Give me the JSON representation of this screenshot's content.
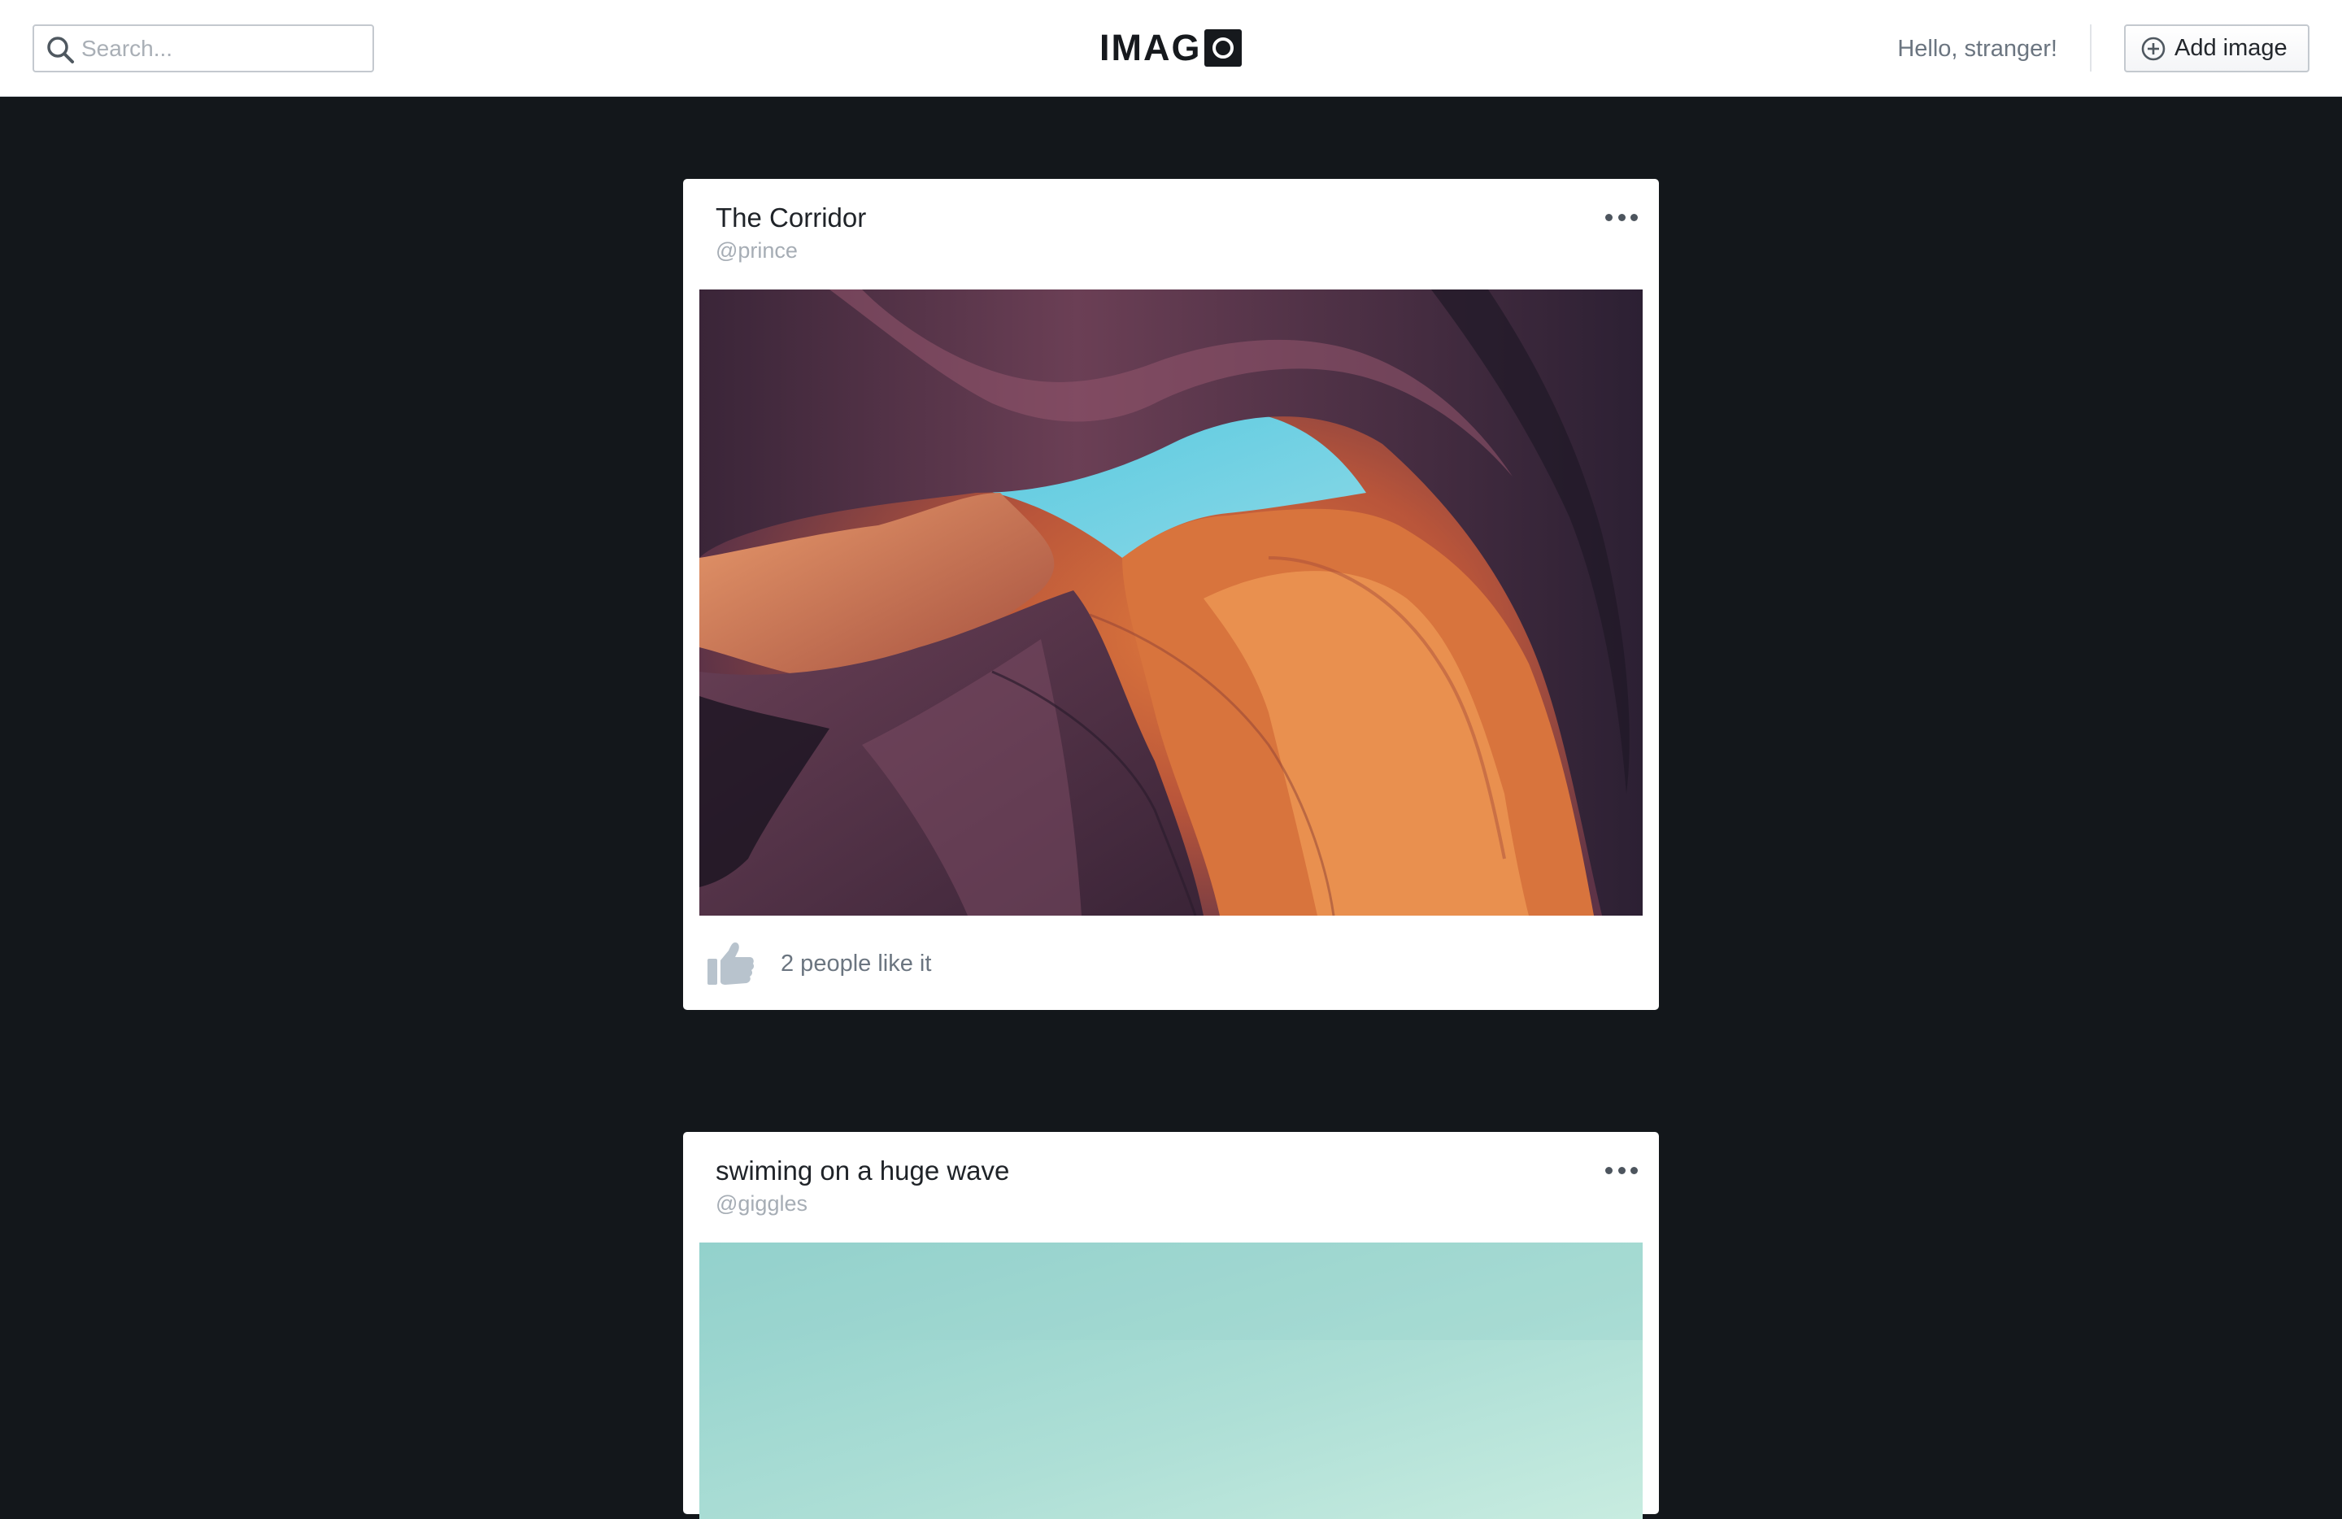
{
  "header": {
    "search_placeholder": "Search...",
    "search_value": "",
    "logo_text": "IMAG",
    "greeting": "Hello, stranger!",
    "add_button_label": "Add image",
    "icons": {
      "search": "search-icon",
      "add": "plus-circle-icon"
    }
  },
  "feed": {
    "posts": [
      {
        "title": "The Corridor",
        "user": "@prince",
        "likes_text": "2 people like it",
        "image_icon": "canyon-photo"
      },
      {
        "title": "swiming on a huge wave",
        "user": "@giggles",
        "image_icon": "wave-photo"
      }
    ]
  },
  "colors": {
    "background": "#13171b",
    "card": "#ffffff",
    "muted_text": "#6b7580",
    "username_text": "#a6adb5",
    "like_icon": "#b8c3cd"
  }
}
